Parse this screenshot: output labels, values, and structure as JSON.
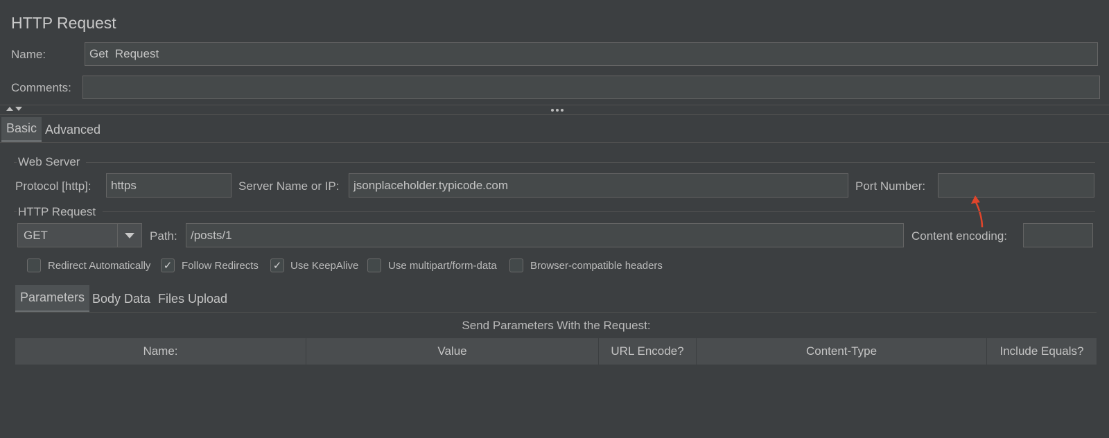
{
  "header": {
    "title": "HTTP Request",
    "name_label": "Name:",
    "name_value": "Get  Request",
    "comments_label": "Comments:",
    "comments_value": ""
  },
  "tabs": [
    {
      "label": "Basic",
      "active": true
    },
    {
      "label": "Advanced",
      "active": false
    }
  ],
  "web_server": {
    "section_title": "Web Server",
    "protocol_label": "Protocol [http]:",
    "protocol_value": "https",
    "server_label": "Server Name or IP:",
    "server_value": "jsonplaceholder.typicode.com",
    "port_label": "Port Number:",
    "port_value": ""
  },
  "http_request": {
    "section_title": "HTTP Request",
    "method_value": "GET",
    "path_label": "Path:",
    "path_value": "/posts/1",
    "encoding_label": "Content encoding:",
    "encoding_value": ""
  },
  "checkboxes": [
    {
      "label": "Redirect Automatically",
      "checked": false
    },
    {
      "label": "Follow Redirects",
      "checked": true
    },
    {
      "label": "Use KeepAlive",
      "checked": true
    },
    {
      "label": "Use multipart/form-data",
      "checked": false
    },
    {
      "label": "Browser-compatible headers",
      "checked": false
    }
  ],
  "subtabs": [
    {
      "label": "Parameters",
      "active": true
    },
    {
      "label": "Body Data",
      "active": false
    },
    {
      "label": "Files Upload",
      "active": false
    }
  ],
  "params": {
    "caption": "Send Parameters With the Request:",
    "columns": [
      "Name:",
      "Value",
      "URL Encode?",
      "Content-Type",
      "Include Equals?"
    ]
  },
  "colors": {
    "background": "#3c3f41",
    "annotation_arrow": "#e0452b"
  }
}
